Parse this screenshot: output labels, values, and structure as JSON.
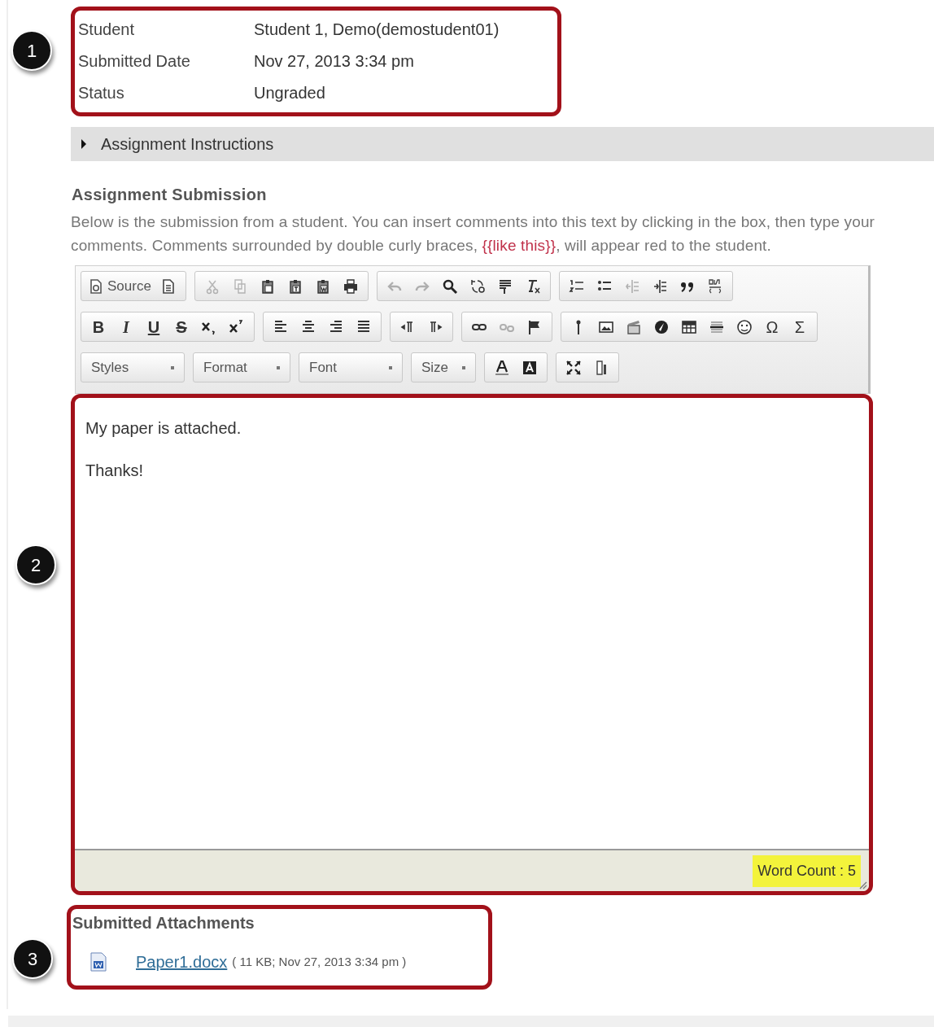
{
  "details": {
    "callout": "1",
    "rows": [
      {
        "label": "Student",
        "value": "Student 1, Demo(demostudent01)"
      },
      {
        "label": "Submitted Date",
        "value": "Nov 27, 2013 3:34 pm"
      },
      {
        "label": "Status",
        "value": "Ungraded"
      }
    ]
  },
  "instructions_toggle": {
    "label": "Assignment Instructions",
    "expanded": false
  },
  "submission": {
    "heading": "Assignment Submission",
    "help": {
      "before": "Below is the submission from a student. You can insert comments into this text by clicking in the box, then type your comments. Comments surrounded by double curly braces, ",
      "example": "{{like this}}",
      "after": ", will appear red to the student."
    }
  },
  "toolbar": {
    "rows": [
      [
        [
          {
            "kind": "source",
            "label": "Source",
            "disabled": false
          },
          {
            "kind": "icon",
            "disabled": false
          }
        ],
        [
          {
            "kind": "icon",
            "disabled": true
          },
          {
            "kind": "icon",
            "disabled": true
          },
          {
            "kind": "icon",
            "disabled": false
          },
          {
            "kind": "icon",
            "disabled": false
          },
          {
            "kind": "icon",
            "disabled": false
          },
          {
            "kind": "icon",
            "disabled": false
          }
        ],
        [
          {
            "kind": "icon",
            "disabled": true
          },
          {
            "kind": "icon",
            "disabled": true
          },
          {
            "kind": "icon",
            "disabled": false
          },
          {
            "kind": "icon",
            "disabled": false
          },
          {
            "kind": "icon",
            "disabled": false
          },
          {
            "kind": "icon",
            "disabled": false
          }
        ],
        [
          {
            "kind": "icon",
            "disabled": false
          },
          {
            "kind": "icon",
            "disabled": false
          },
          {
            "kind": "icon",
            "disabled": true
          },
          {
            "kind": "icon",
            "disabled": false
          },
          {
            "kind": "icon",
            "disabled": false
          },
          {
            "kind": "icon",
            "disabled": false
          }
        ]
      ],
      [
        [
          {
            "kind": "glyph",
            "label": "B",
            "disabled": false
          },
          {
            "kind": "glyph",
            "label": "I",
            "disabled": false
          },
          {
            "kind": "glyph",
            "label": "U",
            "disabled": false
          },
          {
            "kind": "glyph",
            "label": "S",
            "disabled": false
          },
          {
            "kind": "icon",
            "disabled": false
          },
          {
            "kind": "icon",
            "disabled": false
          }
        ],
        [
          {
            "kind": "icon",
            "disabled": false
          },
          {
            "kind": "icon",
            "disabled": false
          },
          {
            "kind": "icon",
            "disabled": false
          },
          {
            "kind": "icon",
            "disabled": false
          }
        ],
        [
          {
            "kind": "icon",
            "disabled": false
          },
          {
            "kind": "icon",
            "disabled": false
          }
        ],
        [
          {
            "kind": "icon",
            "disabled": false
          },
          {
            "kind": "icon",
            "disabled": true
          },
          {
            "kind": "icon",
            "disabled": false
          }
        ],
        [
          {
            "kind": "icon",
            "disabled": false
          },
          {
            "kind": "icon",
            "disabled": false
          },
          {
            "kind": "icon",
            "disabled": false
          },
          {
            "kind": "icon",
            "disabled": false
          },
          {
            "kind": "icon",
            "disabled": false
          },
          {
            "kind": "icon",
            "disabled": false
          },
          {
            "kind": "icon",
            "disabled": false
          },
          {
            "kind": "glyph",
            "label": "Ω",
            "disabled": false
          },
          {
            "kind": "glyph",
            "label": "Σ",
            "disabled": false
          }
        ]
      ],
      [
        [
          {
            "kind": "combo",
            "label": "Styles"
          }
        ],
        [
          {
            "kind": "combo",
            "label": "Format"
          }
        ],
        [
          {
            "kind": "combo",
            "label": "Font"
          }
        ],
        [
          {
            "kind": "combo",
            "label": "Size"
          }
        ],
        [
          {
            "kind": "icon",
            "disabled": false
          },
          {
            "kind": "icon",
            "disabled": false
          }
        ],
        [
          {
            "kind": "icon",
            "disabled": false
          },
          {
            "kind": "icon",
            "disabled": false
          }
        ]
      ]
    ]
  },
  "editor": {
    "callout": "2",
    "paragraphs": [
      "My paper is attached.",
      "Thanks!"
    ],
    "word_count": "Word Count : 5"
  },
  "attachments": {
    "callout": "3",
    "heading": "Submitted Attachments",
    "files": [
      {
        "name": "Paper1.docx",
        "meta": "( 11 KB; Nov 27, 2013 3:34 pm )"
      }
    ]
  }
}
